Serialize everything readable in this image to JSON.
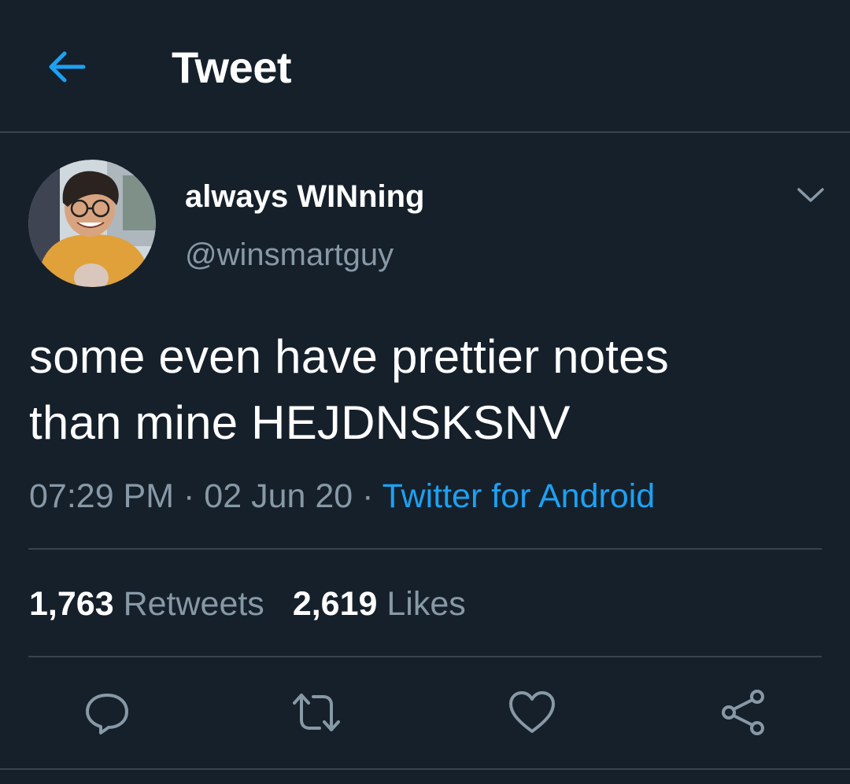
{
  "header": {
    "title": "Tweet",
    "back_icon": "arrow-left-icon"
  },
  "tweet": {
    "author": {
      "display_name": "always WINning",
      "handle": "@winsmartguy"
    },
    "text_line1": "some even have prettier notes",
    "text_line2": "than mine HEJDNSKSNV",
    "time": "07:29 PM",
    "date": "02 Jun 20",
    "separator": "·",
    "source": "Twitter for Android",
    "stats": {
      "retweets_count": "1,763",
      "retweets_label": "Retweets",
      "likes_count": "2,619",
      "likes_label": "Likes"
    },
    "actions": [
      "reply-icon",
      "retweet-icon",
      "like-icon",
      "share-icon"
    ]
  },
  "colors": {
    "background": "#15202b",
    "accent": "#1da1f2",
    "secondary_text": "#8899a6",
    "divider": "#38444d"
  }
}
